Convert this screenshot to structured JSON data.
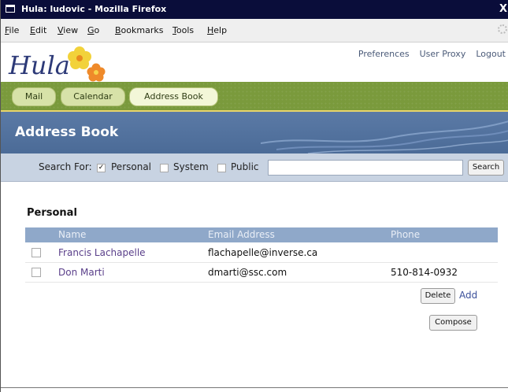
{
  "window": {
    "title": "Hula: ludovic - Mozilla Firefox",
    "close_glyph": "X"
  },
  "menubar": {
    "items": [
      {
        "label": "File",
        "mnemonic": "F",
        "rest": "ile"
      },
      {
        "label": "Edit",
        "mnemonic": "E",
        "rest": "dit"
      },
      {
        "label": "View",
        "mnemonic": "V",
        "rest": "iew"
      },
      {
        "label": "Go",
        "mnemonic": "G",
        "rest": "o"
      },
      {
        "label": "Bookmarks",
        "mnemonic": "B",
        "rest": "ookmarks"
      },
      {
        "label": "Tools",
        "mnemonic": "T",
        "rest": "ools"
      },
      {
        "label": "Help",
        "mnemonic": "H",
        "rest": "elp"
      }
    ]
  },
  "header": {
    "logo_text": "Hula",
    "links": [
      "Preferences",
      "User Proxy",
      "Logout"
    ]
  },
  "tabs": [
    {
      "label": "Mail",
      "active": false
    },
    {
      "label": "Calendar",
      "active": false
    },
    {
      "label": "Address Book",
      "active": true
    }
  ],
  "page": {
    "heading": "Address Book"
  },
  "search": {
    "label": "Search For:",
    "options": [
      {
        "label": "Personal",
        "checked": true
      },
      {
        "label": "System",
        "checked": false
      },
      {
        "label": "Public",
        "checked": false
      }
    ],
    "input_value": "",
    "button_label": "Search",
    "check_glyph": "✓"
  },
  "contacts": {
    "section_title": "Personal",
    "columns": [
      "Name",
      "Email Address",
      "Phone"
    ],
    "rows": [
      {
        "name": "Francis Lachapelle",
        "email": "flachapelle@inverse.ca",
        "phone": "",
        "checked": false
      },
      {
        "name": "Don Marti",
        "email": "dmarti@ssc.com",
        "phone": "510-814-0932",
        "checked": false
      }
    ],
    "delete_label": "Delete",
    "add_label": "Add",
    "compose_label": "Compose"
  },
  "colors": {
    "titlebar": "#0a0d3a",
    "tab_band": "#7a9a3c",
    "banner": "#4b6b97",
    "search_bar": "#c8d3e2",
    "table_header": "#8fa8c9",
    "link_purple": "#5a3f8a"
  }
}
